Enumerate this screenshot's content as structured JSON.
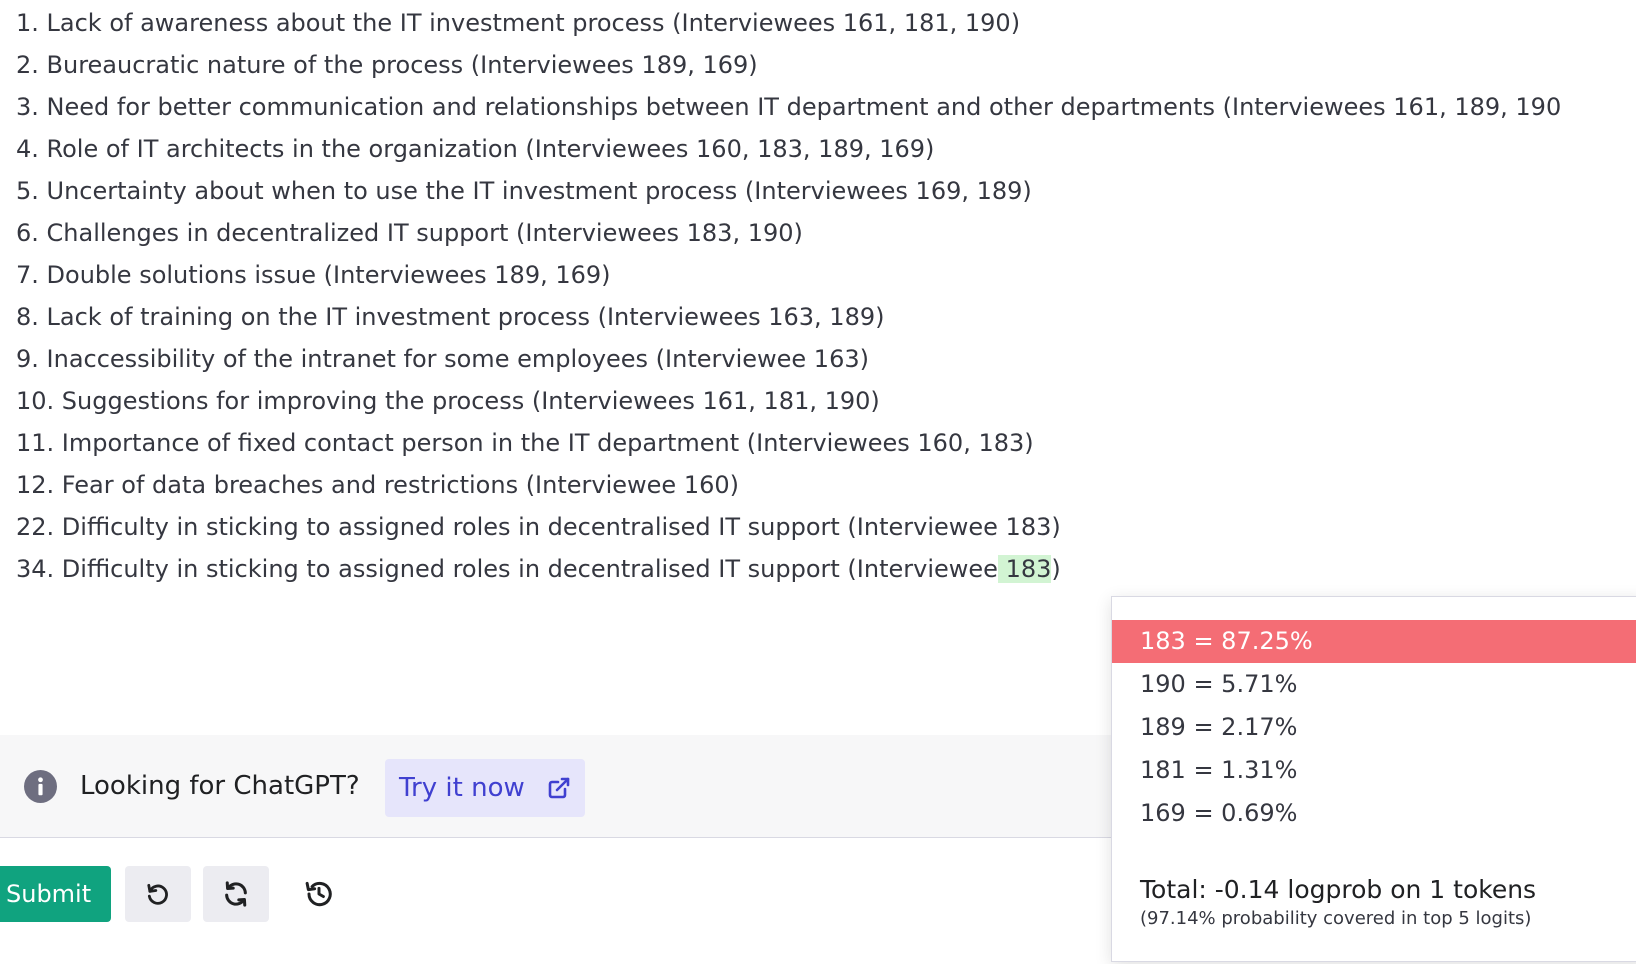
{
  "output": {
    "lines": [
      "1. Lack of awareness about the IT investment process (Interviewees 161, 181, 190)",
      "2. Bureaucratic nature of the process (Interviewees 189, 169)",
      "3. Need for better communication and relationships between IT department and other departments (Interviewees 161, 189, 190",
      "4. Role of IT architects in the organization (Interviewees 160, 183, 189, 169)",
      "5. Uncertainty about when to use the IT investment process (Interviewees 169, 189)",
      "6. Challenges in decentralized IT support (Interviewees 183, 190)",
      "7. Double solutions issue (Interviewees 189, 169)",
      "8. Lack of training on the IT investment process (Interviewees 163, 189)",
      "9. Inaccessibility of the intranet for some employees (Interviewee 163)",
      "10. Suggestions for improving the process (Interviewees 161, 181, 190)",
      "11. Importance of fixed contact person in the IT department (Interviewees 160, 183)",
      "12. Fear of data breaches and restrictions (Interviewee 160)",
      "22. Difficulty in sticking to assigned roles in decentralised IT support (Interviewee 183)"
    ],
    "last_line_prefix": "34. Difficulty in sticking to assigned roles in decentralised IT support (Interviewee",
    "last_line_token": " 183",
    "last_line_suffix": ")"
  },
  "notice": {
    "text": "Looking for ChatGPT?",
    "link_label": "Try it now",
    "info_icon": "info-icon",
    "link_icon": "external-link-icon"
  },
  "toolbar": {
    "submit_label": "Submit",
    "undo_icon": "undo-icon",
    "regenerate_icon": "regenerate-icon",
    "history_icon": "history-icon"
  },
  "probabilities": {
    "rows": [
      {
        "label": "183 = 87.25%",
        "selected": true
      },
      {
        "label": "190 = 5.71%",
        "selected": false
      },
      {
        "label": "189 = 2.17%",
        "selected": false
      },
      {
        "label": "181 = 1.31%",
        "selected": false
      },
      {
        "label": "169 = 0.69%",
        "selected": false
      }
    ],
    "total": "Total: -0.14 logprob on 1 tokens",
    "coverage": "(97.14% probability covered in top 5 logits)"
  },
  "colors": {
    "accent": "#10a37f",
    "selected_row": "#f46d75",
    "token_highlight": "#d2f4d3",
    "link": "#4040d0"
  }
}
